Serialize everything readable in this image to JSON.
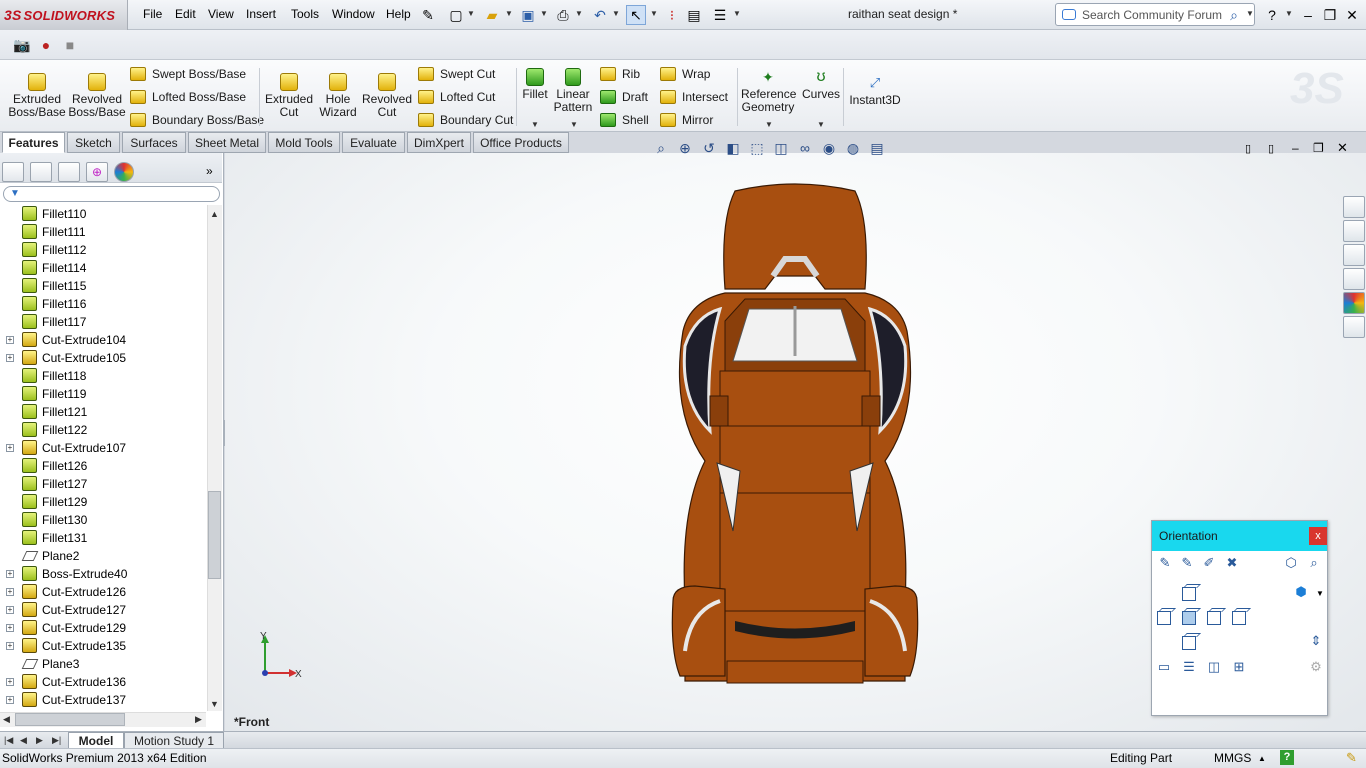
{
  "app": {
    "brand": "SOLIDWORKS",
    "brand_mark": "3S",
    "document_title": "raithan seat design *",
    "search_placeholder": "Search Community Forum",
    "menus": [
      "File",
      "Edit",
      "View",
      "Insert",
      "Tools",
      "Window",
      "Help"
    ]
  },
  "command_manager": {
    "extruded_boss": "Extruded Boss/Base",
    "revolved_boss": "Revolved Boss/Base",
    "swept_boss": "Swept Boss/Base",
    "lofted_boss": "Lofted Boss/Base",
    "boundary_boss": "Boundary Boss/Base",
    "extruded_cut": "Extruded Cut",
    "hole_wizard": "Hole Wizard",
    "revolved_cut": "Revolved Cut",
    "swept_cut": "Swept Cut",
    "lofted_cut": "Lofted Cut",
    "boundary_cut": "Boundary Cut",
    "fillet": "Fillet",
    "linear_pattern": "Linear Pattern",
    "rib": "Rib",
    "draft": "Draft",
    "shell": "Shell",
    "wrap": "Wrap",
    "intersect": "Intersect",
    "mirror": "Mirror",
    "reference_geometry": "Reference Geometry",
    "curves": "Curves",
    "instant3d": "Instant3D"
  },
  "tabs": [
    "Features",
    "Sketch",
    "Surfaces",
    "Sheet Metal",
    "Mold Tools",
    "Evaluate",
    "DimXpert",
    "Office Products"
  ],
  "feature_tree": [
    {
      "label": "Fillet110",
      "kind": "fillet",
      "expand": false
    },
    {
      "label": "Fillet111",
      "kind": "fillet",
      "expand": false
    },
    {
      "label": "Fillet112",
      "kind": "fillet",
      "expand": false
    },
    {
      "label": "Fillet114",
      "kind": "fillet",
      "expand": false
    },
    {
      "label": "Fillet115",
      "kind": "fillet",
      "expand": false
    },
    {
      "label": "Fillet116",
      "kind": "fillet",
      "expand": false
    },
    {
      "label": "Fillet117",
      "kind": "fillet",
      "expand": false
    },
    {
      "label": "Cut-Extrude104",
      "kind": "cut",
      "expand": true
    },
    {
      "label": "Cut-Extrude105",
      "kind": "cut",
      "expand": true
    },
    {
      "label": "Fillet118",
      "kind": "fillet",
      "expand": false
    },
    {
      "label": "Fillet119",
      "kind": "fillet",
      "expand": false
    },
    {
      "label": "Fillet121",
      "kind": "fillet",
      "expand": false
    },
    {
      "label": "Fillet122",
      "kind": "fillet",
      "expand": false
    },
    {
      "label": "Cut-Extrude107",
      "kind": "cut",
      "expand": true
    },
    {
      "label": "Fillet126",
      "kind": "fillet",
      "expand": false
    },
    {
      "label": "Fillet127",
      "kind": "fillet",
      "expand": false
    },
    {
      "label": "Fillet129",
      "kind": "fillet",
      "expand": false
    },
    {
      "label": "Fillet130",
      "kind": "fillet",
      "expand": false
    },
    {
      "label": "Fillet131",
      "kind": "fillet",
      "expand": false
    },
    {
      "label": "Plane2",
      "kind": "plane",
      "expand": false
    },
    {
      "label": "Boss-Extrude40",
      "kind": "fillet",
      "expand": true
    },
    {
      "label": "Cut-Extrude126",
      "kind": "cut",
      "expand": true
    },
    {
      "label": "Cut-Extrude127",
      "kind": "cut",
      "expand": true
    },
    {
      "label": "Cut-Extrude129",
      "kind": "cut",
      "expand": true
    },
    {
      "label": "Cut-Extrude135",
      "kind": "cut",
      "expand": true
    },
    {
      "label": "Plane3",
      "kind": "plane",
      "expand": false
    },
    {
      "label": "Cut-Extrude136",
      "kind": "cut",
      "expand": true
    },
    {
      "label": "Cut-Extrude137",
      "kind": "cut",
      "expand": true
    }
  ],
  "viewport": {
    "view_label": "*Front",
    "triad_x": "X",
    "triad_y": "Y",
    "model_color": "#a84f10"
  },
  "orientation": {
    "title": "Orientation",
    "close": "x"
  },
  "bottom_tabs": [
    "Model",
    "Motion Study 1"
  ],
  "status": {
    "edition": "SolidWorks Premium 2013 x64 Edition",
    "mode": "Editing Part",
    "units": "MMGS"
  },
  "colors": {
    "accent_cyan": "#19d8ee",
    "brand_red": "#c0111e",
    "close_red": "#d9352d"
  }
}
